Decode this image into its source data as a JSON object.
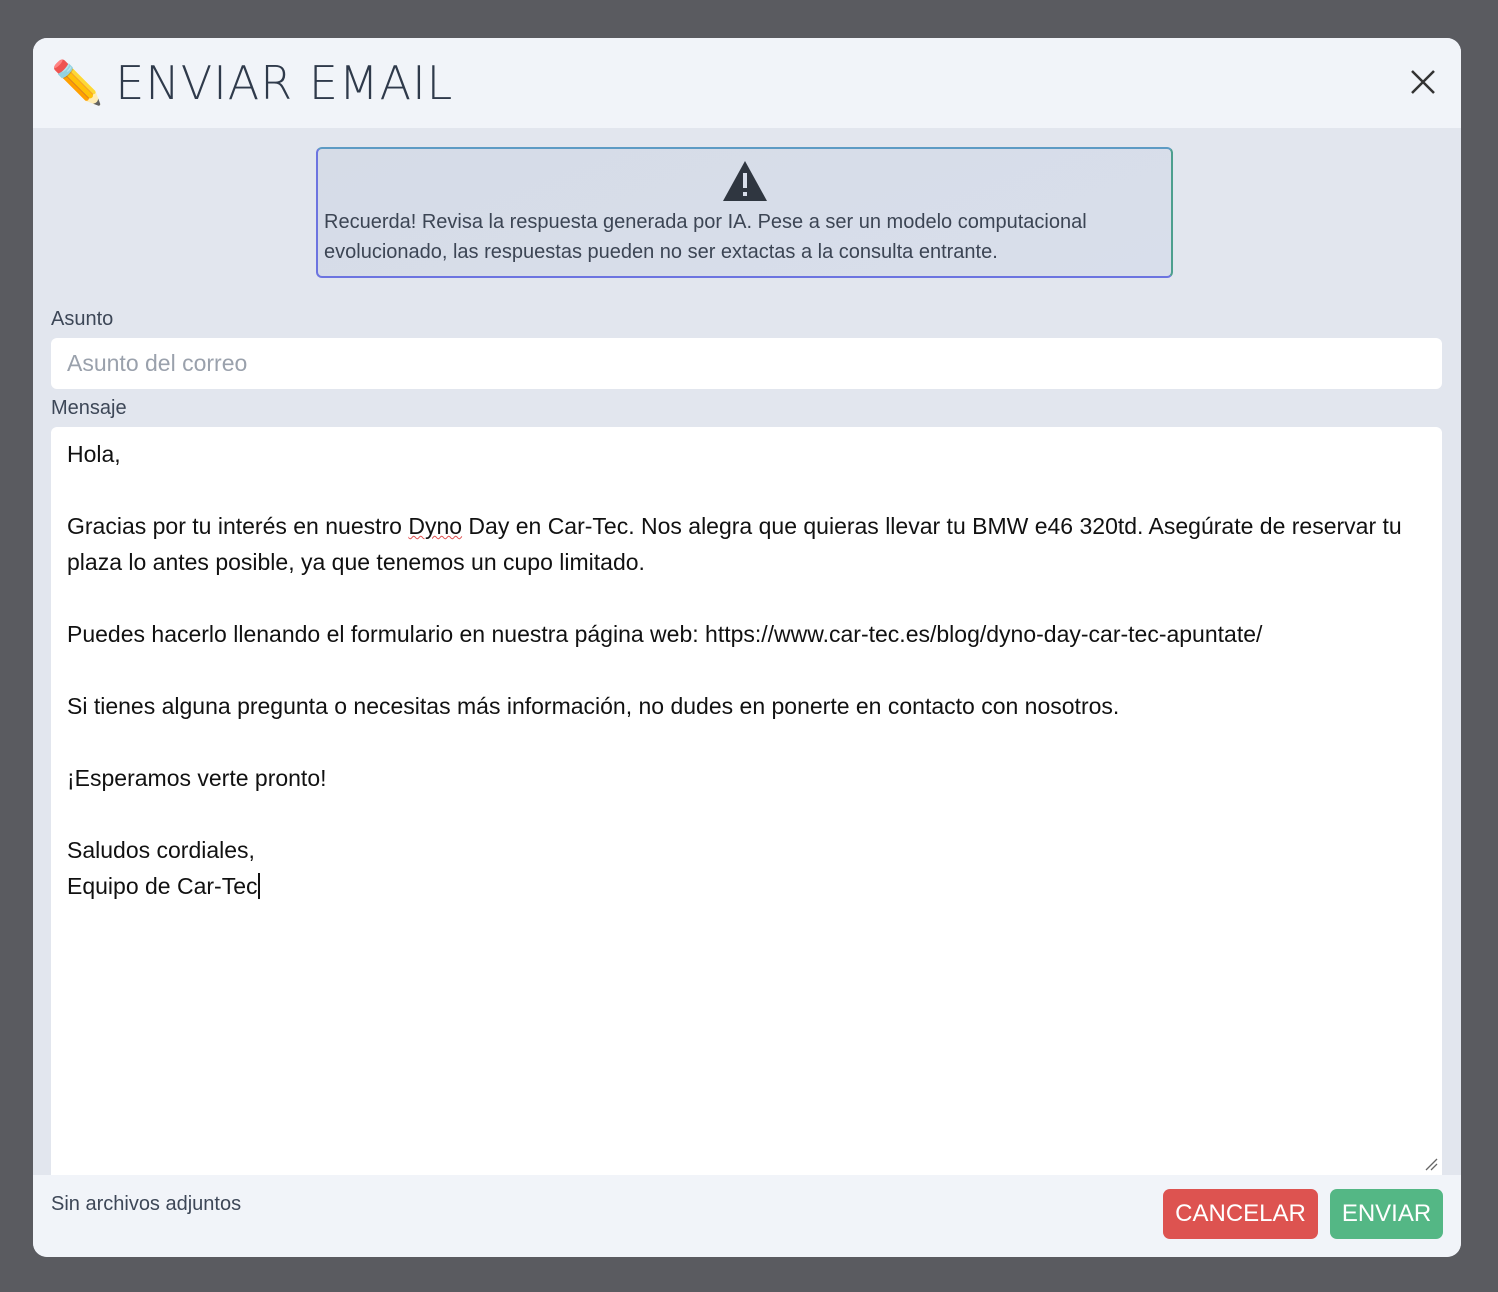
{
  "modal": {
    "title": "ENVIAR EMAIL",
    "title_icon": "pencil-icon",
    "close_icon": "close-icon",
    "alert": {
      "icon": "warning-icon",
      "text": "Recuerda! Revisa la respuesta generada por IA. Pese a ser un modelo computacional evolucionado, las respuestas pueden no ser extactas a la consulta entrante."
    },
    "subject": {
      "label": "Asunto",
      "value": "",
      "placeholder": "Asunto del correo"
    },
    "message": {
      "label": "Mensaje",
      "lines": {
        "l1": "Hola,",
        "l2a": "Gracias por tu interés en nuestro ",
        "l2b": "Dyno",
        "l2c": " Day en Car-Tec. Nos alegra que quieras llevar tu BMW e46 320td. Asegúrate de reservar tu plaza lo antes posible, ya que tenemos un cupo limitado.",
        "l3": "Puedes hacerlo llenando el formulario en nuestra página web: https://www.car-tec.es/blog/dyno-day-car-tec-apuntate/",
        "l4": "Si tienes alguna pregunta o necesitas más información, no dudes en ponerte en contacto con nosotros.",
        "l5": "¡Esperamos verte pronto!",
        "l6": "Saludos cordiales,",
        "l7": "Equipo de Car-Tec"
      }
    },
    "footer": {
      "attachments": "Sin archivos adjuntos",
      "cancel_label": "CANCELAR",
      "send_label": "ENVIAR"
    },
    "colors": {
      "cancel": "#dd5350",
      "send": "#54b785"
    }
  }
}
